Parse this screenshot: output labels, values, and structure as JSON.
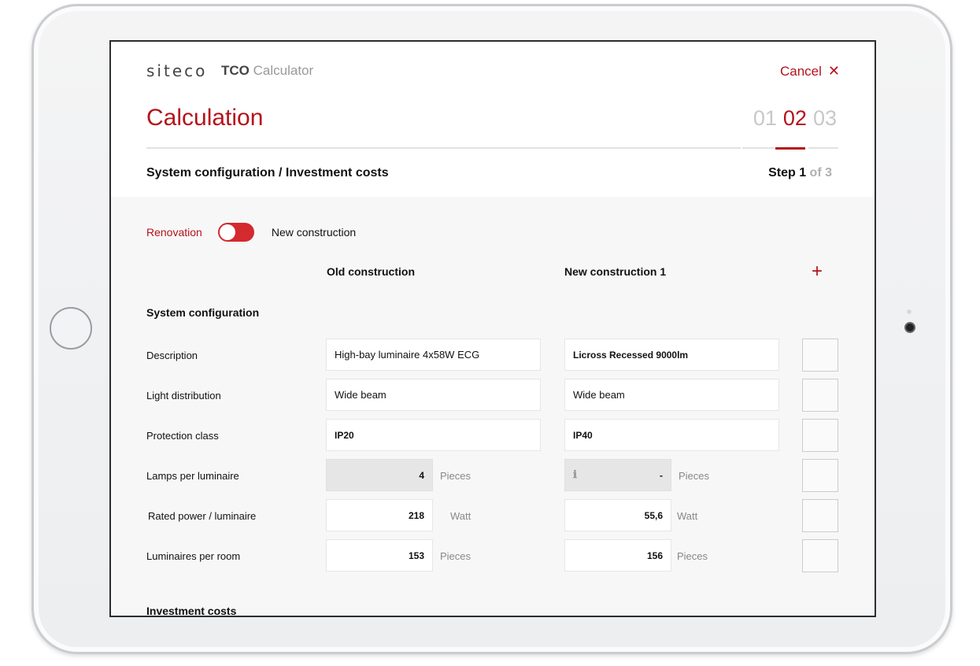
{
  "header": {
    "logo": "siteco",
    "app_name_bold": "TCO",
    "app_name": "Calculator",
    "cancel_label": "Cancel",
    "title": "Calculation",
    "steps": [
      "01",
      "02",
      "03"
    ],
    "subtitle": "System configuration / Investment costs",
    "step_prefix": "Step",
    "step_current": "1",
    "step_total": "of 3"
  },
  "toggle": {
    "left_label": "Renovation",
    "right_label": "New construction",
    "state": "on"
  },
  "columns": {
    "old": "Old construction",
    "new1": "New construction 1"
  },
  "sections": {
    "system_configuration": "System configuration",
    "investment_costs": "Investment costs"
  },
  "rows": [
    {
      "label": "Description",
      "old": "High-bay luminaire 4x58W ECG",
      "new": "Licross Recessed 9000lm"
    },
    {
      "label": "Light distribution",
      "old": "Wide beam",
      "new": "Wide beam"
    },
    {
      "label": "Protection class",
      "old": "IP20",
      "new": "IP40"
    },
    {
      "label": "Lamps per luminaire",
      "old": "4",
      "new": "-",
      "unit": "Pieces"
    },
    {
      "label": "Rated power / luminaire",
      "old": "218",
      "new": "55,6",
      "unit": "Watt"
    },
    {
      "label": "Luminaires per room",
      "old": "153",
      "new": "156",
      "unit": "Pieces"
    }
  ],
  "icons": {
    "close": "close-icon",
    "add": "plus-icon",
    "info": "info-icon"
  },
  "colors": {
    "accent": "#b5121b",
    "toggle": "#d3292f"
  }
}
